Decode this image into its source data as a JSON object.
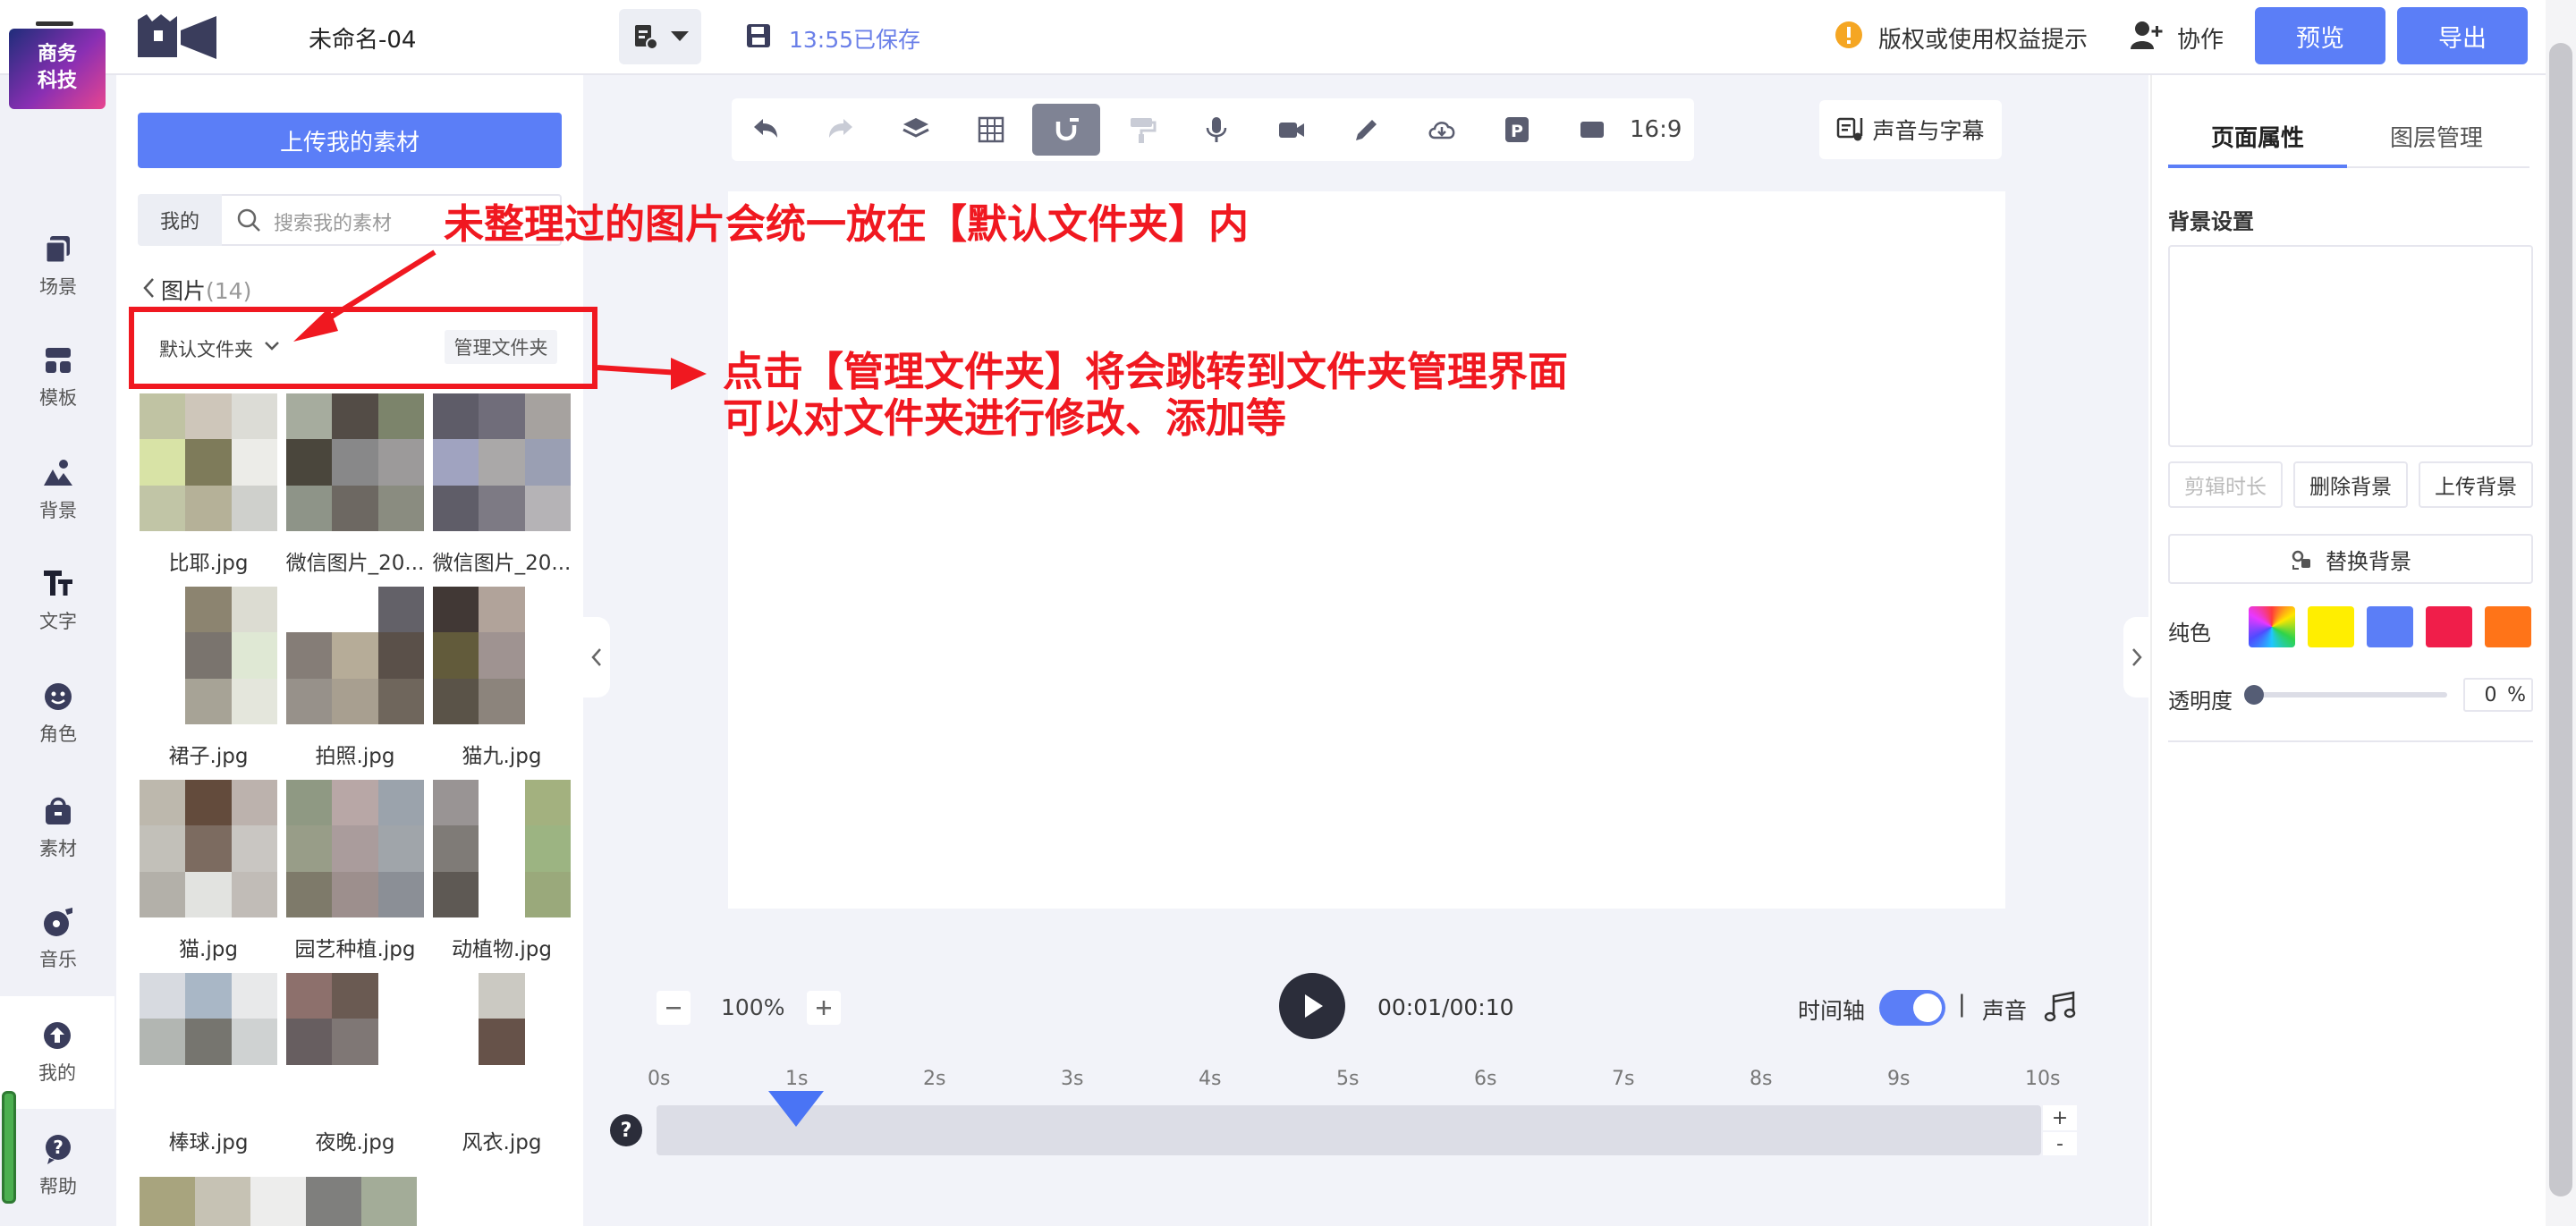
{
  "header": {
    "doc_title": "未命名-04",
    "save_status": "13:55已保存",
    "copyright_tip": "版权或使用权益提示",
    "collab": "协作",
    "preview": "预览",
    "export": "导出"
  },
  "leftnav": {
    "avatar_line1": "商务",
    "avatar_line2": "科技",
    "items": [
      {
        "label": "场景",
        "icon": "scene-icon"
      },
      {
        "label": "模板",
        "icon": "template-icon"
      },
      {
        "label": "背景",
        "icon": "background-icon"
      },
      {
        "label": "文字",
        "icon": "text-icon"
      },
      {
        "label": "角色",
        "icon": "character-icon"
      },
      {
        "label": "素材",
        "icon": "material-icon"
      },
      {
        "label": "音乐",
        "icon": "music-icon"
      },
      {
        "label": "我的",
        "icon": "mine-icon"
      },
      {
        "label": "帮助",
        "icon": "help-icon"
      }
    ]
  },
  "assets": {
    "upload": "上传我的素材",
    "tab_mine": "我的",
    "search_placeholder": "搜索我的素材",
    "crumb": "图片",
    "crumb_count": "(14)",
    "folder": "默认文件夹",
    "manage": "管理文件夹",
    "files": [
      {
        "name": "比耶.jpg",
        "colors": [
          "#c0c3a3",
          "#cec6ba",
          "#dcdcd6",
          "#d8e3a6",
          "#7e7b5a",
          "#ecece8",
          "#c1c5a6",
          "#b5b198",
          "#cfd0cc"
        ]
      },
      {
        "name": "微信图片_20...",
        "colors": [
          "#a6ac9e",
          "#534c46",
          "#7c846b",
          "#4a463c",
          "#888889",
          "#9c9a9a",
          "#8e9488",
          "#6d6862",
          "#8a8c80"
        ]
      },
      {
        "name": "微信图片_20...",
        "colors": [
          "#5e5c68",
          "#706d7a",
          "#a6a29f",
          "#a0a3c0",
          "#aaa8a8",
          "#9a9fb3",
          "#5f5d68",
          "#7d7a84",
          "#b5b3b6"
        ]
      },
      {
        "name": "裙子.jpg",
        "colors": [
          "#ffffff",
          "#8c8470",
          "#dcdcd2",
          "#ffffff",
          "#7a746e",
          "#dfe8d4",
          "#ffffff",
          "#a7a396",
          "#e4e6dc"
        ]
      },
      {
        "name": "拍照.jpg",
        "colors": [
          "#ffffff",
          "#ffffff",
          "#636168",
          "#857d77",
          "#b6ac98",
          "#5a5049",
          "#97918a",
          "#a89f90",
          "#6f665c"
        ]
      },
      {
        "name": "猫九.jpg",
        "colors": [
          "#413835",
          "#b1a39a",
          "#ffffff",
          "#625b3b",
          "#9f9391",
          "#ffffff",
          "#5a5348",
          "#8c847c",
          "#ffffff"
        ]
      },
      {
        "name": "猫.jpg",
        "colors": [
          "#bdb8ad",
          "#634b3c",
          "#bcb2ad",
          "#c2c0b9",
          "#7c6b60",
          "#c9c6c2",
          "#b3b0a9",
          "#e2e3e0",
          "#c1bcb7"
        ]
      },
      {
        "name": "园艺种植.jpg",
        "colors": [
          "#8f9983",
          "#b8a7a6",
          "#9ba3ac",
          "#989d88",
          "#aa9c9c",
          "#a0a5aa",
          "#7e7a6a",
          "#9d8f8d",
          "#8b8f96"
        ]
      },
      {
        "name": "动植物.jpg",
        "colors": [
          "#999494",
          "#ffffff",
          "#a3b17f",
          "#7f7b77",
          "#ffffff",
          "#9cb482",
          "#5e5954",
          "#ffffff",
          "#9aa97b"
        ]
      },
      {
        "name": "棒球.jpg",
        "colors": [
          "#d7dae0",
          "#a9b7c6",
          "#e8e9ea",
          "#b2b6b2",
          "#76756f",
          "#cfd2d2",
          "#ffffff",
          "#ffffff",
          "#ffffff"
        ]
      },
      {
        "name": "夜晚.jpg",
        "colors": [
          "#8d706c",
          "#6a5a52",
          "#ffffff",
          "#675e60",
          "#7f7775",
          "#ffffff",
          "#ffffff",
          "#ffffff",
          "#ffffff"
        ]
      },
      {
        "name": "风衣.jpg",
        "colors": [
          "#ffffff",
          "#cbc9c2",
          "#ffffff",
          "#ffffff",
          "#665249",
          "#ffffff",
          "#ffffff",
          "#ffffff",
          "#ffffff"
        ]
      }
    ],
    "partial_colors": [
      "#a8a47e",
      "#c6c2b4",
      "#ededec",
      "#7f7f7d",
      "#a3ac98"
    ]
  },
  "toolbar": {
    "tools": [
      "undo-icon",
      "redo-icon",
      "layers-icon",
      "grid-icon",
      "magnet-icon",
      "paint-roller-icon",
      "microphone-icon",
      "camera-icon",
      "pencil-icon",
      "cloud-icon",
      "parking-icon",
      "ratio-icon"
    ],
    "ratio": "16:9",
    "voice_subtitle": "声音与字幕"
  },
  "playback": {
    "zoom": "100%",
    "time": "00:01/00:10",
    "timeline": "时间轴",
    "separator": "|",
    "sound": "声音",
    "ticks": [
      "0s",
      "1s",
      "2s",
      "3s",
      "4s",
      "5s",
      "6s",
      "7s",
      "8s",
      "9s",
      "10s"
    ],
    "playhead_seconds": 1,
    "timeline_on": true
  },
  "rightpanel": {
    "tab_page": "页面属性",
    "tab_layer": "图层管理",
    "bg_title": "背景设置",
    "btn_trim": "剪辑时长",
    "btn_delete": "删除背景",
    "btn_upload": "上传背景",
    "replace": "替换背景",
    "pure_color": "纯色",
    "swatches": [
      "rainbow",
      "#ffee00",
      "#5b7ef7",
      "#f01e4a",
      "#ff7418"
    ],
    "opacity_label": "透明度",
    "opacity_value": "0",
    "opacity_unit": "%"
  },
  "annotations": {
    "note1": "未整理过的图片会统一放在【默认文件夹】内",
    "note2_line1": "点击【管理文件夹】将会跳转到文件夹管理界面",
    "note2_line2": "可以对文件夹进行修改、添加等"
  }
}
